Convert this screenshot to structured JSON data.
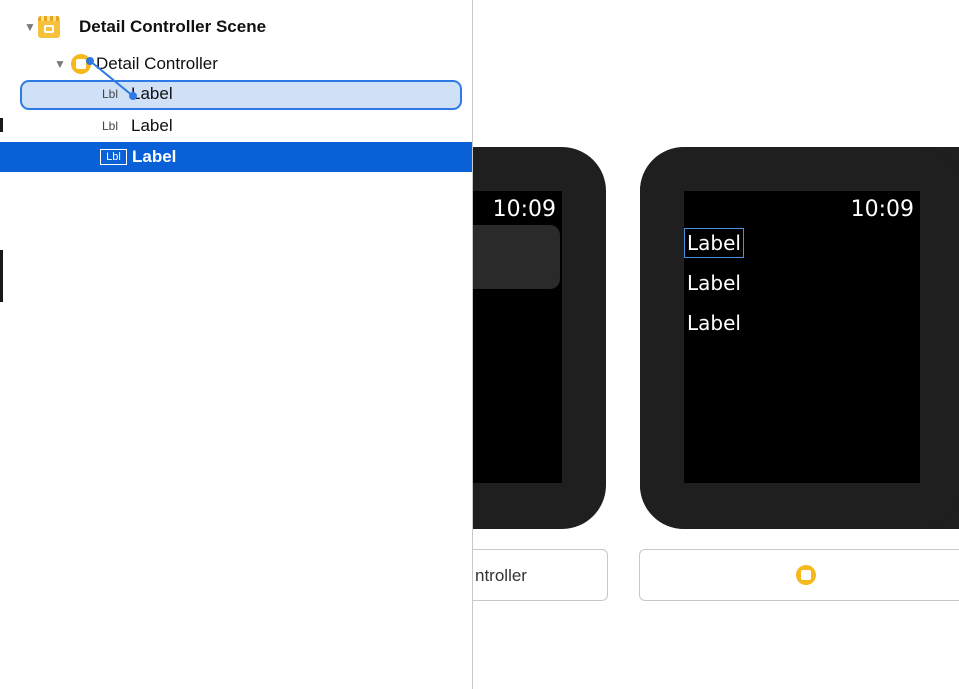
{
  "outline": {
    "scene": {
      "title": "Detail Controller Scene"
    },
    "controller": {
      "title": "Detail Controller"
    },
    "items": [
      {
        "badge": "Lbl",
        "label": "Label"
      },
      {
        "badge": "Lbl",
        "label": "Label"
      },
      {
        "badge": "Lbl",
        "label": "Label"
      }
    ]
  },
  "canvas": {
    "watch_left": {
      "time": "10:09"
    },
    "watch_right": {
      "time": "10:09",
      "labels": [
        "Label",
        "Label",
        "Label"
      ]
    },
    "scene_button_left": {
      "text": "ntroller"
    }
  },
  "colors": {
    "selection": "#0a60d6",
    "highlight": "#cfe0f7",
    "connection": "#2d7ae6",
    "controller_icon": "#f5b91e"
  }
}
